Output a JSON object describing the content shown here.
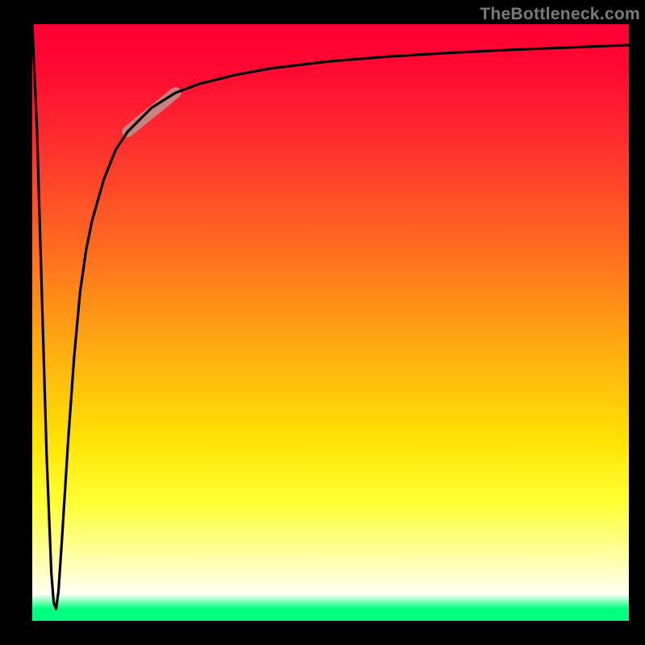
{
  "watermark": {
    "text": "TheBottleneck.com"
  },
  "chart_data": {
    "type": "line",
    "title": "",
    "xlabel": "",
    "ylabel": "",
    "xlim": [
      0,
      100
    ],
    "ylim": [
      0,
      100
    ],
    "grid": false,
    "legend": false,
    "gradient_stops": [
      {
        "pos": 0.0,
        "color": "#ff0033"
      },
      {
        "pos": 0.2,
        "color": "#ff3a2c"
      },
      {
        "pos": 0.4,
        "color": "#ff821b"
      },
      {
        "pos": 0.6,
        "color": "#ffc508"
      },
      {
        "pos": 0.78,
        "color": "#fff400"
      },
      {
        "pos": 0.93,
        "color": "#ffffd2"
      },
      {
        "pos": 1.0,
        "color": "#00ff80"
      }
    ],
    "series": [
      {
        "name": "bottleneck-curve",
        "x": [
          0,
          0.8,
          1.6,
          2.4,
          3.2,
          3.6,
          4.0,
          4.4,
          5.0,
          6.0,
          7.0,
          8.0,
          9.0,
          10,
          12,
          14,
          16,
          20,
          24,
          28,
          34,
          40,
          50,
          60,
          70,
          80,
          90,
          100
        ],
        "y": [
          100,
          82,
          55,
          28,
          8,
          3,
          2,
          5,
          14,
          30,
          44,
          55,
          62,
          67,
          74,
          79,
          82,
          86,
          88.5,
          90,
          91.5,
          92.6,
          93.8,
          94.6,
          95.2,
          95.7,
          96.1,
          96.5
        ]
      },
      {
        "name": "highlight-segment",
        "x": [
          16,
          24
        ],
        "y": [
          82,
          88.5
        ],
        "style": "thick-muted"
      }
    ]
  }
}
